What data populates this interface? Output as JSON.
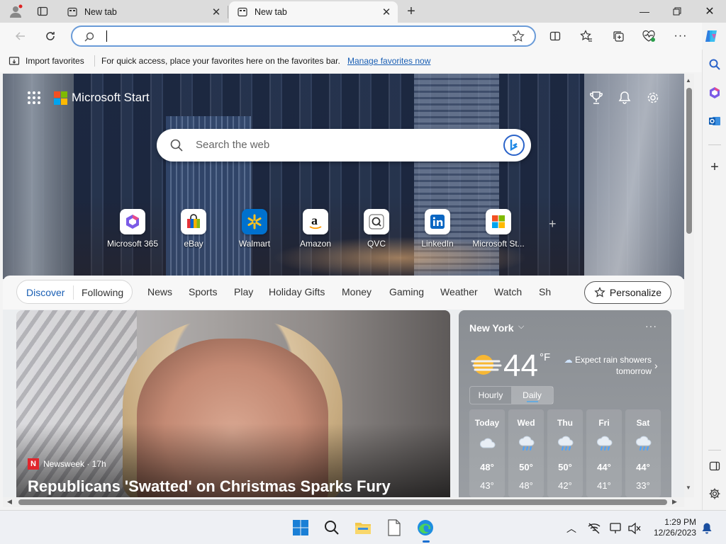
{
  "tabs": [
    {
      "label": "New tab",
      "active": false
    },
    {
      "label": "New tab",
      "active": true
    }
  ],
  "address": {
    "value": "",
    "placeholder": ""
  },
  "favorites_bar": {
    "import_label": "Import favorites",
    "message": "For quick access, place your favorites here on the favorites bar.",
    "manage_link": "Manage favorites now"
  },
  "header": {
    "brand": "Microsoft Start"
  },
  "hero_search": {
    "placeholder": "Search the web"
  },
  "quick_links": [
    {
      "name": "Microsoft 365"
    },
    {
      "name": "eBay"
    },
    {
      "name": "Walmart"
    },
    {
      "name": "Amazon"
    },
    {
      "name": "QVC"
    },
    {
      "name": "LinkedIn"
    },
    {
      "name": "Microsoft St..."
    }
  ],
  "nav": {
    "discover": "Discover",
    "following": "Following",
    "items": [
      "News",
      "Sports",
      "Play",
      "Holiday Gifts",
      "Money",
      "Gaming",
      "Weather",
      "Watch",
      "Sh"
    ],
    "personalize": "Personalize"
  },
  "news": {
    "source_logo": "N",
    "source": "Newsweek · 17h",
    "headline": "Republicans 'Swatted' on Christmas Sparks Fury"
  },
  "weather": {
    "city": "New York",
    "temp": "44",
    "unit": "°F",
    "forecast_line1": "Expect rain showers",
    "forecast_line2": "tomorrow",
    "hourly": "Hourly",
    "daily": "Daily",
    "days": [
      {
        "name": "Today",
        "hi": "48°",
        "lo": "43°",
        "icon": "cloud-icon"
      },
      {
        "name": "Wed",
        "hi": "50°",
        "lo": "48°",
        "icon": "rain-icon"
      },
      {
        "name": "Thu",
        "hi": "50°",
        "lo": "42°",
        "icon": "rain-icon"
      },
      {
        "name": "Fri",
        "hi": "44°",
        "lo": "41°",
        "icon": "rain-icon"
      },
      {
        "name": "Sat",
        "hi": "44°",
        "lo": "33°",
        "icon": "rain-icon"
      }
    ]
  },
  "taskbar": {
    "time": "1:29 PM",
    "date": "12/26/2023"
  },
  "colors": {
    "accent": "#1a5fb4",
    "address_border": "#6a9bd8"
  }
}
